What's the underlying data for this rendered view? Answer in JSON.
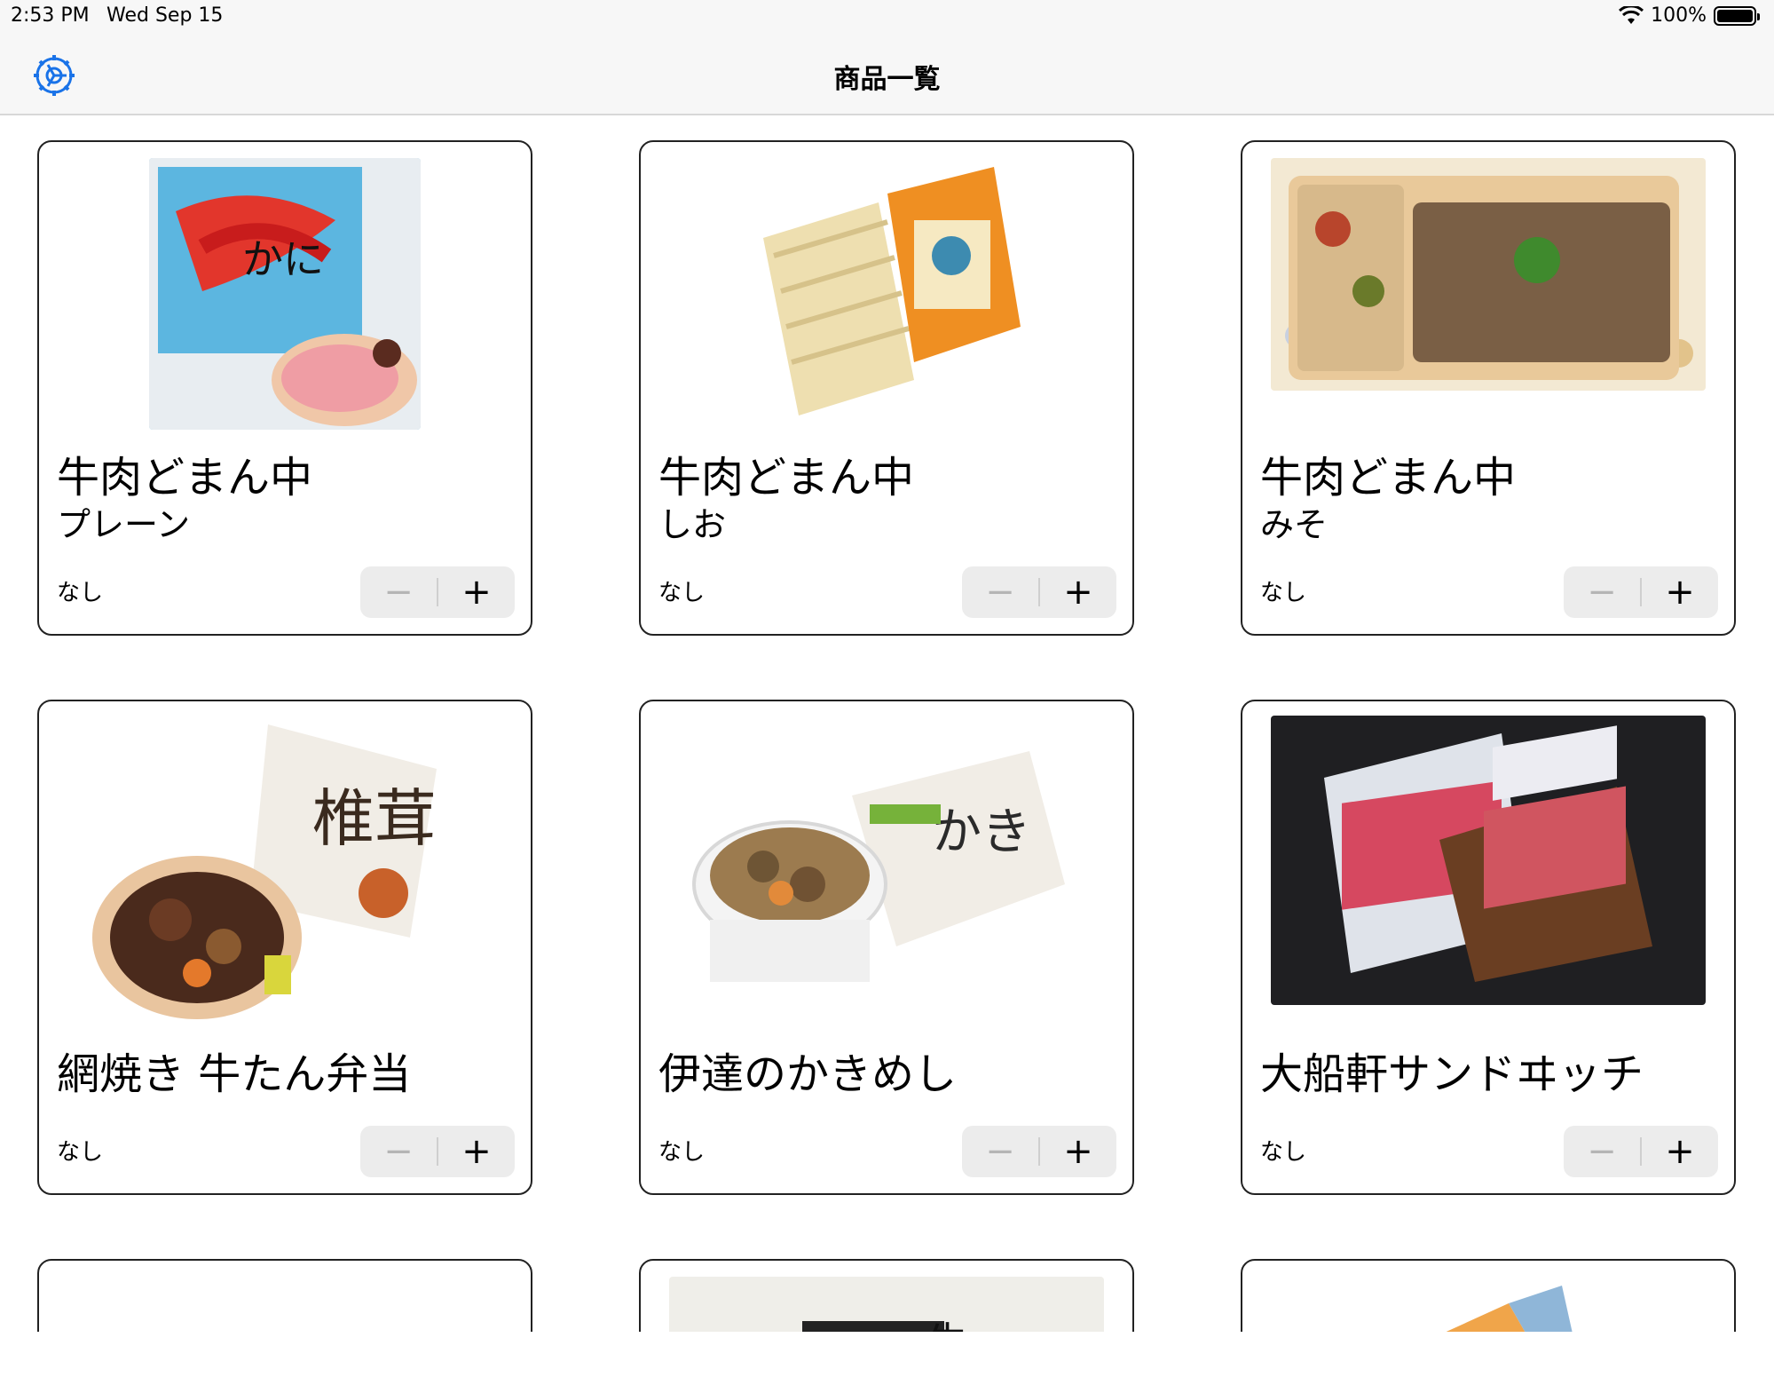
{
  "status": {
    "time": "2:53 PM",
    "date": "Wed Sep 15",
    "battery": "100%"
  },
  "nav": {
    "title": "商品一覧",
    "settings_icon": "gear-icon"
  },
  "products": [
    {
      "name": "牛肉どまん中",
      "variant": "プレーン",
      "count": "なし"
    },
    {
      "name": "牛肉どまん中",
      "variant": "しお",
      "count": "なし"
    },
    {
      "name": "牛肉どまん中",
      "variant": "みそ",
      "count": "なし"
    },
    {
      "name": "網焼き 牛たん弁当",
      "variant": "",
      "count": "なし"
    },
    {
      "name": "伊達のかきめし",
      "variant": "",
      "count": "なし"
    },
    {
      "name": "大船軒サンドヰッチ",
      "variant": "",
      "count": "なし"
    }
  ],
  "stepper": {
    "minus": "−",
    "plus": "+"
  },
  "colors": {
    "accent": "#1a73e8"
  }
}
